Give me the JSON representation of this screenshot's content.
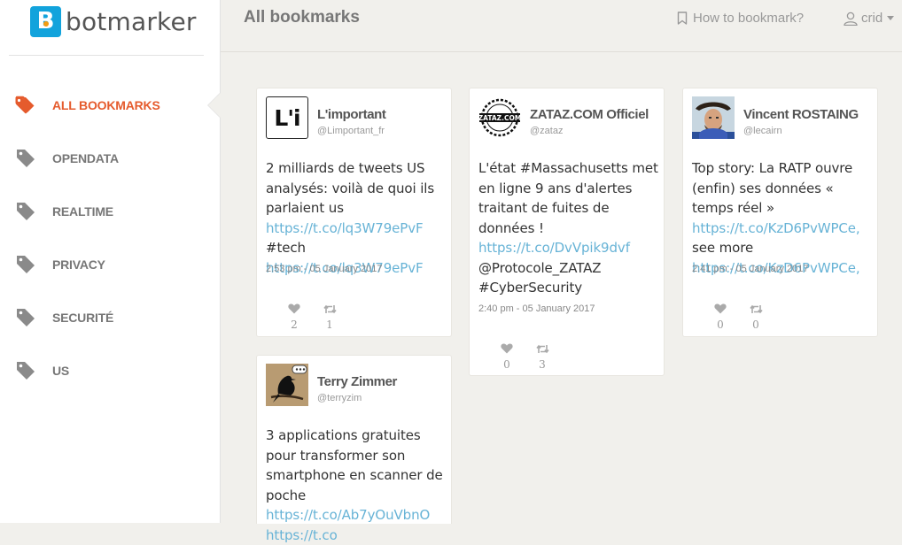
{
  "app": {
    "logo_letter": "B",
    "logo_text": "botmarker"
  },
  "sidebar": {
    "items": [
      {
        "label": "ALL BOOKMARKS",
        "active": true
      },
      {
        "label": "OPENDATA",
        "active": false
      },
      {
        "label": "REALTIME",
        "active": false
      },
      {
        "label": "PRIVACY",
        "active": false
      },
      {
        "label": "SECURITÉ",
        "active": false
      },
      {
        "label": "US",
        "active": false
      }
    ]
  },
  "header": {
    "title": "All bookmarks",
    "how_to": "How to bookmark?",
    "user": "crid"
  },
  "colors": {
    "accent": "#e55b2d",
    "link": "#67b3d6",
    "logo": "#12a3dc"
  },
  "cards": [
    {
      "name": "L'important",
      "handle": "@Limportant_fr",
      "avatar_text": "L'i",
      "tweet": [
        {
          "t": "2 milliards de tweets US analysés: voilà de quoi ils parlaient us "
        },
        {
          "t": "https://t.co/lq3W79ePvF",
          "link": true
        },
        {
          "t": " #tech "
        },
        {
          "t": "https://t.co/lq3W79ePvF",
          "link": true
        }
      ],
      "time": "2:53 pm - 05 January 2017",
      "likes": "2",
      "retweets": "1"
    },
    {
      "name": "ZATAZ.COM Officiel",
      "handle": "@zataz",
      "avatar_text": "ZATAZ.COM",
      "tweet": [
        {
          "t": "L'état #Massachusetts met en ligne 9 ans d'alertes traitant de fuites de données ! "
        },
        {
          "t": "https://t.co/DvVpik9dvf",
          "link": true
        },
        {
          "t": " @Protocole_ZATAZ #CyberSecurity"
        }
      ],
      "time": "2:40 pm - 05 January 2017",
      "likes": "0",
      "retweets": "3"
    },
    {
      "name": "Vincent ROSTAING",
      "handle": "@lecairn",
      "avatar_text": "",
      "tweet": [
        {
          "t": "Top story: La RATP ouvre (enfin) ses données « temps réel » "
        },
        {
          "t": "https://t.co/KzD6PvWPCe,",
          "link": true
        },
        {
          "t": " see more "
        },
        {
          "t": "https://t.co/KzD6PvWPCe,",
          "link": true
        }
      ],
      "time": "2:41 pm - 05 January 2017",
      "likes": "0",
      "retweets": "0"
    },
    {
      "name": "Terry Zimmer",
      "handle": "@terryzim",
      "avatar_text": "",
      "tweet": [
        {
          "t": "3 applications gratuites pour transformer son smartphone en scanner de poche "
        },
        {
          "t": "https://t.co/Ab7yOuVbnO",
          "link": true
        },
        {
          "t": " "
        },
        {
          "t": "https://t.co",
          "link": true
        }
      ],
      "time": "",
      "likes": "",
      "retweets": ""
    }
  ]
}
